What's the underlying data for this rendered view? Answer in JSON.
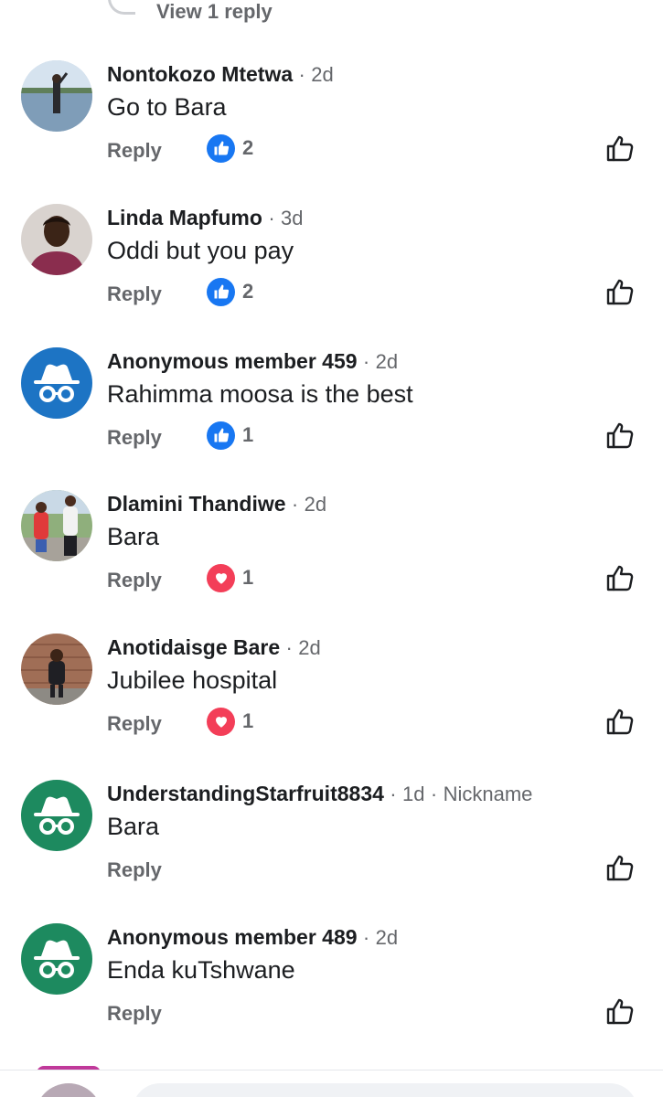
{
  "view_reply": {
    "label": "View 1 reply"
  },
  "comments": [
    {
      "author": "Nontokozo Mtetwa",
      "time": "2d",
      "tag": "",
      "text": "Go to Bara",
      "reply_label": "Reply",
      "reaction": "like",
      "count": "2",
      "avatar": "photo-lake",
      "avatar_color": "#9cb7cf"
    },
    {
      "author": "Linda Mapfumo",
      "time": "3d",
      "tag": "",
      "text": "Oddi but you pay",
      "reply_label": "Reply",
      "reaction": "like",
      "count": "2",
      "avatar": "photo-portrait",
      "avatar_color": "#8a2d4e"
    },
    {
      "author": "Anonymous member 459",
      "time": "2d",
      "tag": "",
      "text": "Rahimma moosa is the best",
      "reply_label": "Reply",
      "reaction": "like",
      "count": "1",
      "avatar": "anonymous-icon",
      "avatar_color": "#1d74c4"
    },
    {
      "author": "Dlamini Thandiwe",
      "time": "2d",
      "tag": "",
      "text": "Bara",
      "reply_label": "Reply",
      "reaction": "love",
      "count": "1",
      "avatar": "photo-people",
      "avatar_color": "#7d9b6a"
    },
    {
      "author": "Anotidaisge Bare",
      "time": "2d",
      "tag": "",
      "text": "Jubilee hospital",
      "reply_label": "Reply",
      "reaction": "love",
      "count": "1",
      "avatar": "photo-child",
      "avatar_color": "#9c6b55"
    },
    {
      "author": "UnderstandingStarfruit8834",
      "time": "1d",
      "tag": "Nickname",
      "text": "Bara",
      "reply_label": "Reply",
      "reaction": "",
      "count": "",
      "avatar": "anonymous-icon",
      "avatar_color": "#1d8a5f"
    },
    {
      "author": "Anonymous member 489",
      "time": "2d",
      "tag": "",
      "text": "Enda kuTshwane",
      "reply_label": "Reply",
      "reaction": "",
      "count": "",
      "avatar": "anonymous-icon",
      "avatar_color": "#1d8a5f"
    }
  ],
  "colors": {
    "like_blue": "#1877f2",
    "love_red": "#f33e58",
    "secondary_text": "#65676b"
  }
}
